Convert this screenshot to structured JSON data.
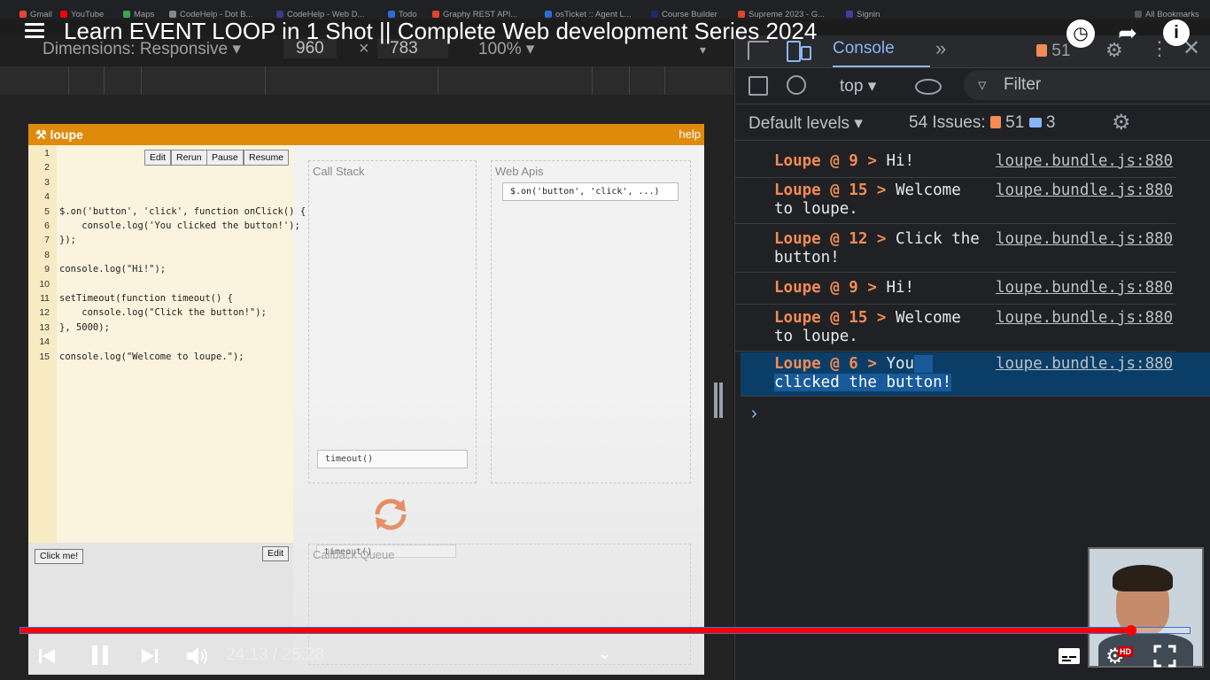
{
  "bookmarks": [
    "Gmail",
    "YouTube",
    "Maps",
    "CodeHelp - Dot B...",
    "CodeHelp - Web D...",
    "Todo",
    "Graphy REST API...",
    "osTicket :: Agent L...",
    "Course Builder",
    "Supreme 2023 - G...",
    "Signin",
    "All Bookmarks"
  ],
  "video": {
    "title": "Learn EVENT LOOP in 1 Shot || Complete Web development Series 2024",
    "current_time": "24:13 / 25:28",
    "progress": 0.95
  },
  "device_toolbar": {
    "dimensions_label": "Dimensions: Responsive ▾",
    "width": "960",
    "height": "783",
    "times": "×",
    "zoom": "100% ▾"
  },
  "loupe": {
    "logo": "loupe",
    "help": "help",
    "editor_buttons": [
      "Edit",
      "Rerun",
      "Pause",
      "Resume"
    ],
    "line_numbers": [
      "1",
      "2",
      "3",
      "4",
      "5",
      "6",
      "7",
      "8",
      "9",
      "10",
      "11",
      "12",
      "13",
      "14",
      "15"
    ],
    "code_lines": [
      "",
      "",
      "",
      "",
      "$.on('button', 'click', function onClick() {",
      "    console.log('You clicked the button!');",
      "});",
      "",
      "console.log(\"Hi!\");",
      "",
      "setTimeout(function timeout() {",
      "    console.log(\"Click the button!\");",
      "}, 5000);",
      "",
      "console.log(\"Welcome to loupe.\");"
    ],
    "click_me": "Click me!",
    "sandbox_edit": "Edit",
    "call_stack_title": "Call Stack",
    "web_apis_title": "Web Apis",
    "web_api_item": "$.on('button', 'click', ...)",
    "call_stack_item": "timeout()",
    "callback_queue_title": "Callback Queue",
    "callback_queue_item": "timeout()"
  },
  "devtools": {
    "active_tab": "Console",
    "issues_badge_count": "51",
    "context": "top ▾",
    "filter_placeholder": "Filter",
    "default_levels": "Default levels ▾",
    "issues_label": "54 Issues:",
    "issues_warn": "51",
    "issues_info": "3",
    "logs": [
      {
        "prefix": "Loupe @ 9 >",
        "message": " Hi!",
        "source": "loupe.bundle.js:880"
      },
      {
        "prefix": "Loupe @ 15 >",
        "message": " Welcome\nto loupe.",
        "source": "loupe.bundle.js:880"
      },
      {
        "prefix": "Loupe @ 12 >",
        "message": " Click the\nbutton!",
        "source": "loupe.bundle.js:880"
      },
      {
        "prefix": "Loupe @ 9 >",
        "message": " Hi!",
        "source": "loupe.bundle.js:880"
      },
      {
        "prefix": "Loupe @ 15 >",
        "message": " Welcome\nto loupe.",
        "source": "loupe.bundle.js:880"
      },
      {
        "prefix": "Loupe @ 6 >",
        "message_a": " You",
        "message_b": "clicked the button!",
        "source": "loupe.bundle.js:880"
      }
    ],
    "prompt": "›"
  },
  "colors": {
    "loupe_orange": "#e08a0b",
    "progress_red": "#ff0000",
    "devtools_accent": "#8ab4f8",
    "issue_orange": "#f28b54"
  }
}
